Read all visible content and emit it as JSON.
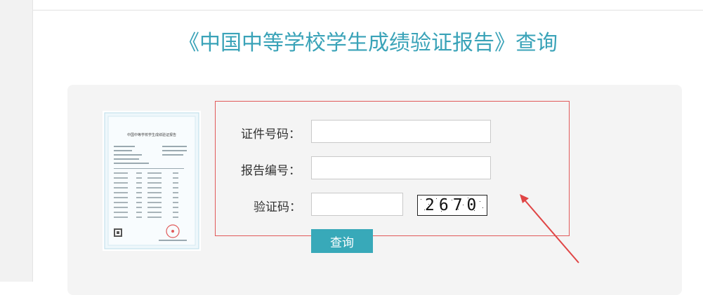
{
  "page": {
    "title": "《中国中等学校学生成绩验证报告》查询"
  },
  "certificate": {
    "heading": "中国中等学校学生成绩验证报告"
  },
  "form": {
    "id_number_label": "证件号码：",
    "id_number_value": "",
    "report_number_label": "报告编号：",
    "report_number_value": "",
    "captcha_label": "验证码：",
    "captcha_value": "",
    "captcha_text": "2670",
    "submit_label": "查询"
  },
  "colors": {
    "title": "#3aa3b8",
    "button": "#38a9b9",
    "highlight_box": "#e15a5a",
    "arrow": "#e04545"
  }
}
